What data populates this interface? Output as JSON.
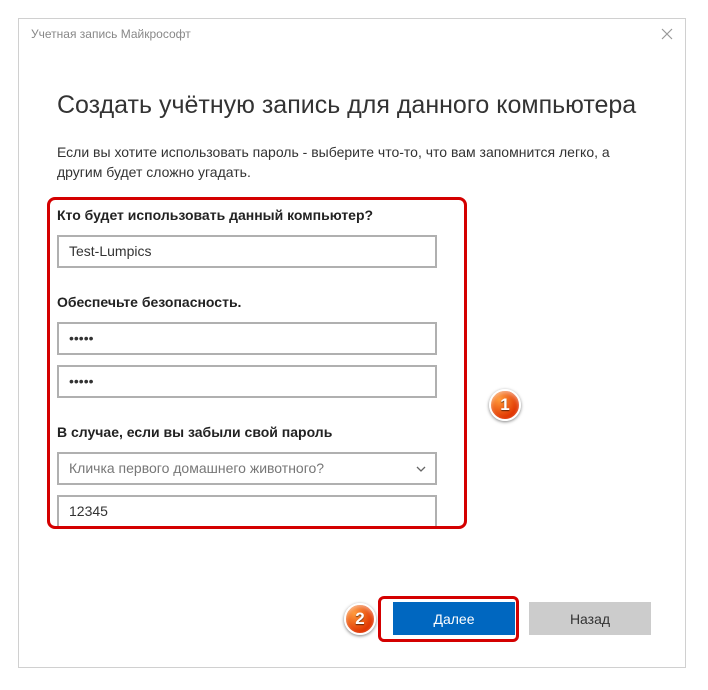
{
  "window": {
    "title": "Учетная запись Майкрософт"
  },
  "heading": "Создать учётную запись для данного компьютера",
  "subtext": "Если вы хотите использовать пароль - выберите что-то, что вам запомнится легко, а другим будет сложно угадать.",
  "form": {
    "who_label": "Кто будет использовать данный компьютер?",
    "username_value": "Test-Lumpics",
    "security_label": "Обеспечьте безопасность.",
    "password_value": "•••••",
    "password_confirm_value": "•••••",
    "forgot_label": "В случае, если вы забыли свой пароль",
    "question_selected": "Кличка первого домашнего животного?",
    "answer_value": "12345"
  },
  "buttons": {
    "next": "Далее",
    "back": "Назад"
  },
  "annotations": {
    "badge1": "1",
    "badge2": "2"
  }
}
